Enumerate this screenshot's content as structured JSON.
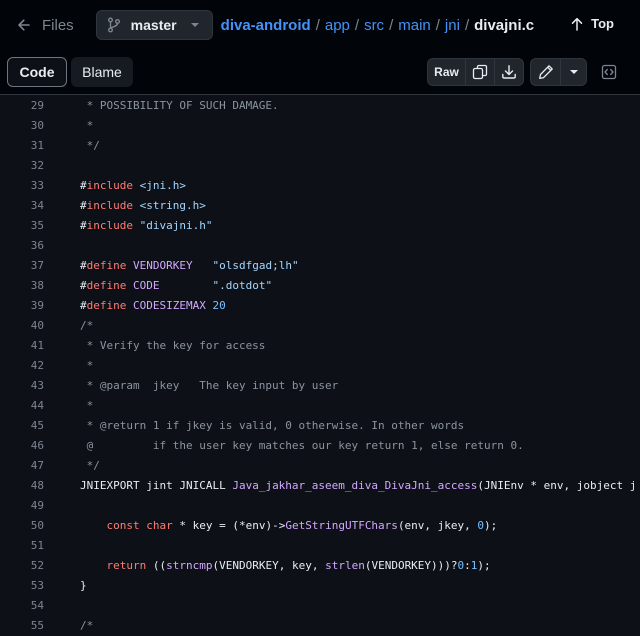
{
  "header": {
    "files_label": "Files",
    "branch": "master",
    "breadcrumb": [
      "diva-android",
      "app",
      "src",
      "main",
      "jni"
    ],
    "separator": "/",
    "file_name": "divajni.c",
    "top_label": "Top"
  },
  "toolbar": {
    "code_tab": "Code",
    "blame_tab": "Blame",
    "raw_label": "Raw"
  },
  "colors": {
    "background": "#0d1117",
    "link": "#4493f8",
    "keyword": "#ff7b72",
    "string": "#a5d6ff",
    "function": "#d2a8ff",
    "constant": "#79c0ff",
    "comment": "#8b949e"
  },
  "code_lines": [
    {
      "num": "29",
      "tokens": [
        [
          "c",
          " * POSSIBILITY OF SUCH DAMAGE."
        ]
      ]
    },
    {
      "num": "30",
      "tokens": [
        [
          "c",
          " *"
        ]
      ]
    },
    {
      "num": "31",
      "tokens": [
        [
          "c",
          " */"
        ]
      ]
    },
    {
      "num": "32",
      "tokens": []
    },
    {
      "num": "33",
      "tokens": [
        [
          "",
          "#"
        ],
        [
          "k",
          "include"
        ],
        [
          "",
          " "
        ],
        [
          "s",
          "<jni.h>"
        ]
      ]
    },
    {
      "num": "34",
      "tokens": [
        [
          "",
          "#"
        ],
        [
          "k",
          "include"
        ],
        [
          "",
          " "
        ],
        [
          "s",
          "<string.h>"
        ]
      ]
    },
    {
      "num": "35",
      "tokens": [
        [
          "",
          "#"
        ],
        [
          "k",
          "include"
        ],
        [
          "",
          " "
        ],
        [
          "s",
          "\"divajni.h\""
        ]
      ]
    },
    {
      "num": "36",
      "tokens": []
    },
    {
      "num": "37",
      "tokens": [
        [
          "",
          "#"
        ],
        [
          "k",
          "define"
        ],
        [
          "",
          " "
        ],
        [
          "m",
          "VENDORKEY"
        ],
        [
          "",
          "   "
        ],
        [
          "s",
          "\"olsdfgad;lh\""
        ]
      ]
    },
    {
      "num": "38",
      "tokens": [
        [
          "",
          "#"
        ],
        [
          "k",
          "define"
        ],
        [
          "",
          " "
        ],
        [
          "m",
          "CODE"
        ],
        [
          "",
          "        "
        ],
        [
          "s",
          "\".dotdot\""
        ]
      ]
    },
    {
      "num": "39",
      "tokens": [
        [
          "",
          "#"
        ],
        [
          "k",
          "define"
        ],
        [
          "",
          " "
        ],
        [
          "m",
          "CODESIZEMAX"
        ],
        [
          "",
          " "
        ],
        [
          "n",
          "20"
        ]
      ]
    },
    {
      "num": "40",
      "tokens": [
        [
          "c",
          "/*"
        ]
      ]
    },
    {
      "num": "41",
      "tokens": [
        [
          "c",
          " * Verify the key for access"
        ]
      ]
    },
    {
      "num": "42",
      "tokens": [
        [
          "c",
          " *"
        ]
      ]
    },
    {
      "num": "43",
      "tokens": [
        [
          "c",
          " * @param  jkey   The key input by user"
        ]
      ]
    },
    {
      "num": "44",
      "tokens": [
        [
          "c",
          " *"
        ]
      ]
    },
    {
      "num": "45",
      "tokens": [
        [
          "c",
          " * @return 1 if jkey is valid, 0 otherwise. In other words"
        ]
      ]
    },
    {
      "num": "46",
      "tokens": [
        [
          "c",
          " @         if the user key matches our key return 1, else return 0."
        ]
      ]
    },
    {
      "num": "47",
      "tokens": [
        [
          "c",
          " */"
        ]
      ]
    },
    {
      "num": "48",
      "tokens": [
        [
          "",
          "JNIEXPORT jint JNICALL "
        ],
        [
          "m",
          "Java_jakhar_aseem_diva_DivaJni_access"
        ],
        [
          "",
          "(JNIEnv * env, jobject j"
        ]
      ]
    },
    {
      "num": "49",
      "tokens": []
    },
    {
      "num": "50",
      "tokens": [
        [
          "",
          "    "
        ],
        [
          "k",
          "const"
        ],
        [
          "",
          " "
        ],
        [
          "k",
          "char"
        ],
        [
          "",
          " * key = (*env)->"
        ],
        [
          "m",
          "GetStringUTFChars"
        ],
        [
          "",
          "(env, jkey, "
        ],
        [
          "n",
          "0"
        ],
        [
          "",
          ");"
        ]
      ]
    },
    {
      "num": "51",
      "tokens": []
    },
    {
      "num": "52",
      "tokens": [
        [
          "",
          "    "
        ],
        [
          "k",
          "return"
        ],
        [
          "",
          " (("
        ],
        [
          "m",
          "strncmp"
        ],
        [
          "",
          "(VENDORKEY, key, "
        ],
        [
          "m",
          "strlen"
        ],
        [
          "",
          "(VENDORKEY)))?"
        ],
        [
          "n",
          "0"
        ],
        [
          "",
          ":"
        ],
        [
          "n",
          "1"
        ],
        [
          "",
          ");"
        ]
      ]
    },
    {
      "num": "53",
      "tokens": [
        [
          "",
          "}"
        ]
      ]
    },
    {
      "num": "54",
      "tokens": []
    },
    {
      "num": "55",
      "tokens": [
        [
          "c",
          "/*"
        ]
      ]
    }
  ]
}
